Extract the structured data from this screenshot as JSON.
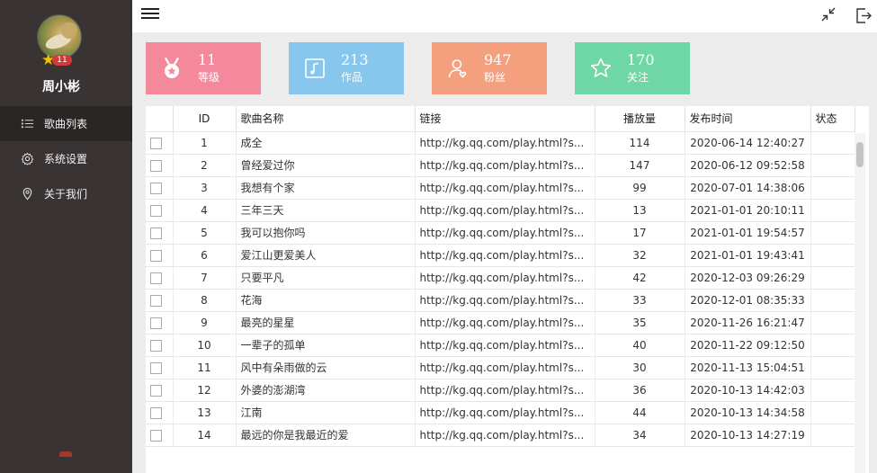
{
  "user": {
    "name": "周小彬",
    "level": "11",
    "star_icon": "star-icon"
  },
  "nav": [
    {
      "label": "歌曲列表",
      "icon": "list-icon",
      "active": true
    },
    {
      "label": "系统设置",
      "icon": "gear-icon",
      "active": false
    },
    {
      "label": "关于我们",
      "icon": "location-pin-icon",
      "active": false
    }
  ],
  "topbar": {
    "menu_icon": "hamburger-menu-icon",
    "compress_icon": "compress-icon",
    "logout_icon": "logout-icon"
  },
  "stats": [
    {
      "value": "11",
      "label": "等级",
      "color": "#f3899b",
      "icon": "medal-icon"
    },
    {
      "value": "213",
      "label": "作品",
      "color": "#87c7ee",
      "icon": "music-note-icon"
    },
    {
      "value": "947",
      "label": "粉丝",
      "color": "#f4a07f",
      "icon": "user-icon"
    },
    {
      "value": "170",
      "label": "关注",
      "color": "#6fd6a6",
      "icon": "star-outline-icon"
    }
  ],
  "table": {
    "headers": {
      "id": "ID",
      "name": "歌曲名称",
      "link": "链接",
      "plays": "播放量",
      "time": "发布时间",
      "status": "状态"
    },
    "rows": [
      {
        "id": "1",
        "name": "成全",
        "link": "http://kg.qq.com/play.html?s...",
        "plays": "114",
        "time": "2020-06-14 12:40:27"
      },
      {
        "id": "2",
        "name": "曾经爱过你",
        "link": "http://kg.qq.com/play.html?s...",
        "plays": "147",
        "time": "2020-06-12 09:52:58"
      },
      {
        "id": "3",
        "name": "我想有个家",
        "link": "http://kg.qq.com/play.html?s...",
        "plays": "99",
        "time": "2020-07-01 14:38:06"
      },
      {
        "id": "4",
        "name": "三年三天",
        "link": "http://kg.qq.com/play.html?s...",
        "plays": "13",
        "time": "2021-01-01 20:10:11"
      },
      {
        "id": "5",
        "name": "我可以抱你吗",
        "link": "http://kg.qq.com/play.html?s...",
        "plays": "17",
        "time": "2021-01-01 19:54:57"
      },
      {
        "id": "6",
        "name": "爱江山更爱美人",
        "link": "http://kg.qq.com/play.html?s...",
        "plays": "32",
        "time": "2021-01-01 19:43:41"
      },
      {
        "id": "7",
        "name": "只要平凡",
        "link": "http://kg.qq.com/play.html?s...",
        "plays": "42",
        "time": "2020-12-03 09:26:29"
      },
      {
        "id": "8",
        "name": "花海",
        "link": "http://kg.qq.com/play.html?s...",
        "plays": "33",
        "time": "2020-12-01 08:35:33"
      },
      {
        "id": "9",
        "name": "最亮的星星",
        "link": "http://kg.qq.com/play.html?s...",
        "plays": "35",
        "time": "2020-11-26 16:21:47"
      },
      {
        "id": "10",
        "name": "一辈子的孤单",
        "link": "http://kg.qq.com/play.html?s...",
        "plays": "40",
        "time": "2020-11-22 09:12:50"
      },
      {
        "id": "11",
        "name": "风中有朵雨做的云",
        "link": "http://kg.qq.com/play.html?s...",
        "plays": "30",
        "time": "2020-11-13 15:04:51"
      },
      {
        "id": "12",
        "name": "外婆的澎湖湾",
        "link": "http://kg.qq.com/play.html?s...",
        "plays": "36",
        "time": "2020-10-13 14:42:03"
      },
      {
        "id": "13",
        "name": "江南",
        "link": "http://kg.qq.com/play.html?s...",
        "plays": "44",
        "time": "2020-10-13 14:34:58"
      },
      {
        "id": "14",
        "name": "最远的你是我最近的爱",
        "link": "http://kg.qq.com/play.html?s...",
        "plays": "34",
        "time": "2020-10-13 14:27:19"
      }
    ]
  }
}
